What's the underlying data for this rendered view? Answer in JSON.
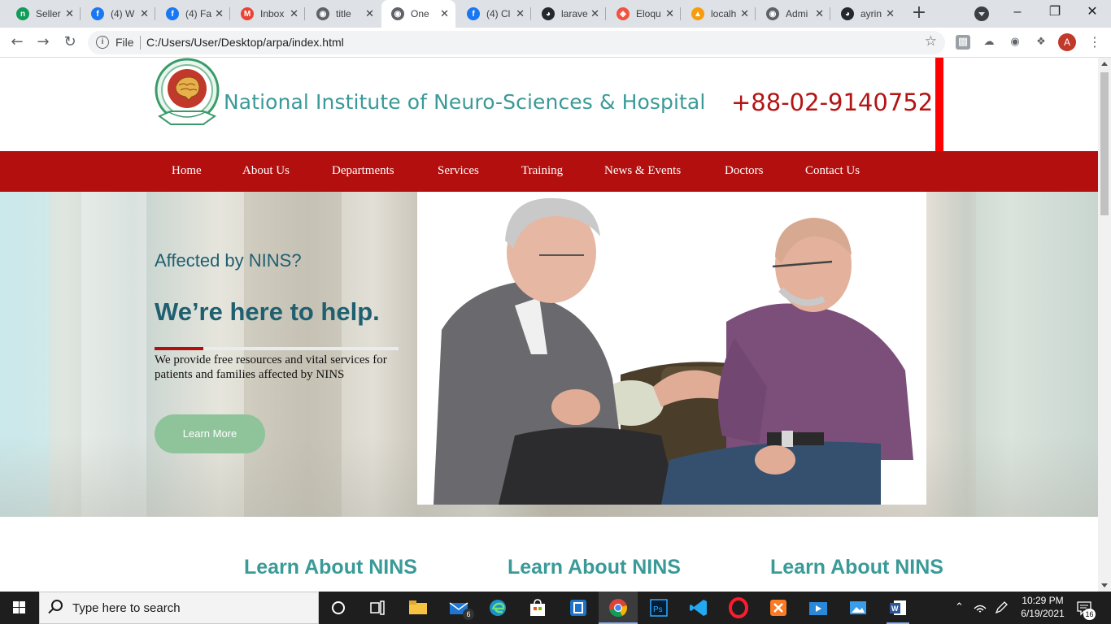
{
  "browser": {
    "tabs": [
      {
        "title": "Seller",
        "fav": "#0f9d58",
        "glyph": "n"
      },
      {
        "title": "(4) W",
        "fav": "#1877f2",
        "glyph": "f"
      },
      {
        "title": "(4) Fa",
        "fav": "#1877f2",
        "glyph": "f"
      },
      {
        "title": "Inbox",
        "fav": "#ea4335",
        "glyph": "M"
      },
      {
        "title": "title",
        "fav": "#5f6368",
        "glyph": "◉"
      },
      {
        "title": "One",
        "fav": "#5f6368",
        "glyph": "◉"
      },
      {
        "title": "(4) Cl",
        "fav": "#1877f2",
        "glyph": "f"
      },
      {
        "title": "larave",
        "fav": "#24292e",
        "glyph": "◕"
      },
      {
        "title": "Eloqu",
        "fav": "#f05340",
        "glyph": "◈"
      },
      {
        "title": "localh",
        "fav": "#f89c0e",
        "glyph": "▲"
      },
      {
        "title": "Admi",
        "fav": "#5f6368",
        "glyph": "◉"
      },
      {
        "title": "ayrin",
        "fav": "#24292e",
        "glyph": "◕"
      }
    ],
    "active_tab": 5,
    "address": {
      "scheme": "File",
      "url": "C:/Users/User/Desktop/arpa/index.html"
    },
    "profile_initial": "A"
  },
  "site": {
    "name": "National Institute of Neuro-Sciences & Hospital",
    "phone": "+88-02-9140752",
    "colors": {
      "teal": "#3a9a98",
      "red": "#b30f0f",
      "button": "#8fc49a"
    }
  },
  "nav": [
    "Home",
    "About Us",
    "Departments",
    "Services",
    "Training",
    "News & Events",
    "Doctors",
    "Contact Us"
  ],
  "hero": {
    "question": "Affected by NINS?",
    "title": "We’re here to help.",
    "text": "We provide free resources and vital services for patients and families affected by NINS",
    "button": "Learn More"
  },
  "learn": {
    "headings": [
      "Learn About NINS",
      "Learn About NINS",
      "Learn About NINS"
    ]
  },
  "taskbar": {
    "search_placeholder": "Type here to search",
    "mail_badge": "6",
    "time": "10:29 PM",
    "date": "6/19/2021",
    "notif_count": "16"
  }
}
